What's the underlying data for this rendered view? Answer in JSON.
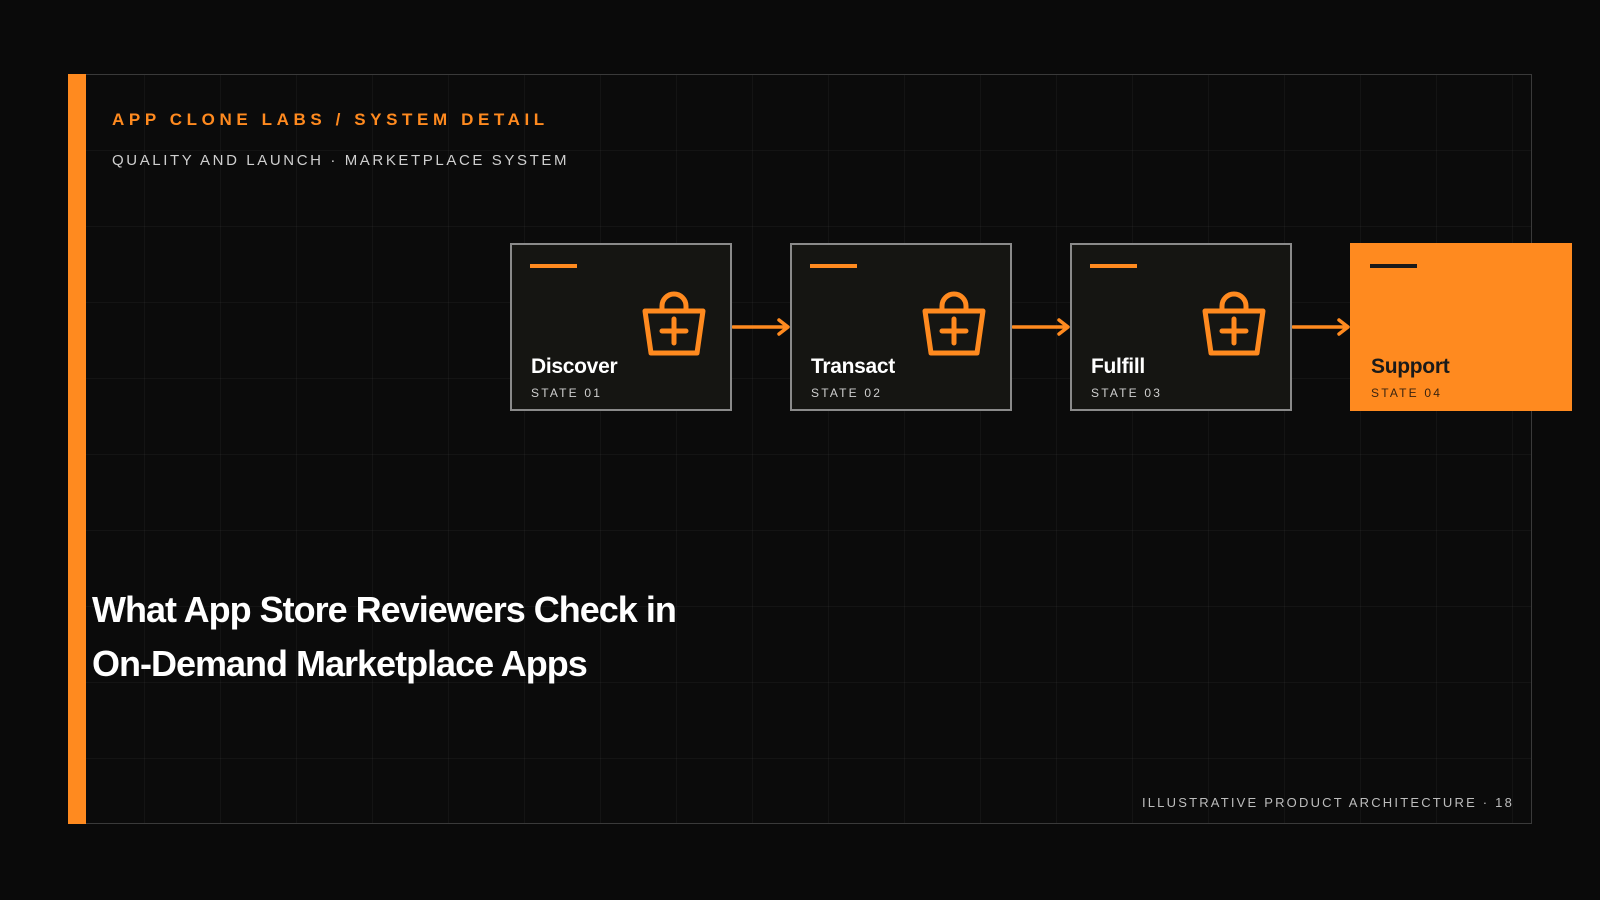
{
  "header": {
    "eyebrow": "APP CLONE LABS / SYSTEM DETAIL",
    "subline": "QUALITY AND LAUNCH · MARKETPLACE SYSTEM"
  },
  "headline": {
    "line1": "What App Store Reviewers Check in",
    "line2": "On-Demand Marketplace Apps"
  },
  "states": [
    {
      "title": "Discover",
      "label": "STATE 01",
      "icon": "shopping-basket-plus-icon",
      "highlighted": false
    },
    {
      "title": "Transact",
      "label": "STATE 02",
      "icon": "shopping-basket-plus-icon",
      "highlighted": false
    },
    {
      "title": "Fulfill",
      "label": "STATE 03",
      "icon": "shopping-basket-plus-icon",
      "highlighted": false
    },
    {
      "title": "Support",
      "label": "STATE 04",
      "highlighted": true
    }
  ],
  "footer": {
    "caption": "ILLUSTRATIVE PRODUCT ARCHITECTURE · 18"
  },
  "colors": {
    "accent": "#ff8a1f",
    "background": "#0a0a0a",
    "card": "#151512",
    "card_border": "#8a8a8a"
  }
}
